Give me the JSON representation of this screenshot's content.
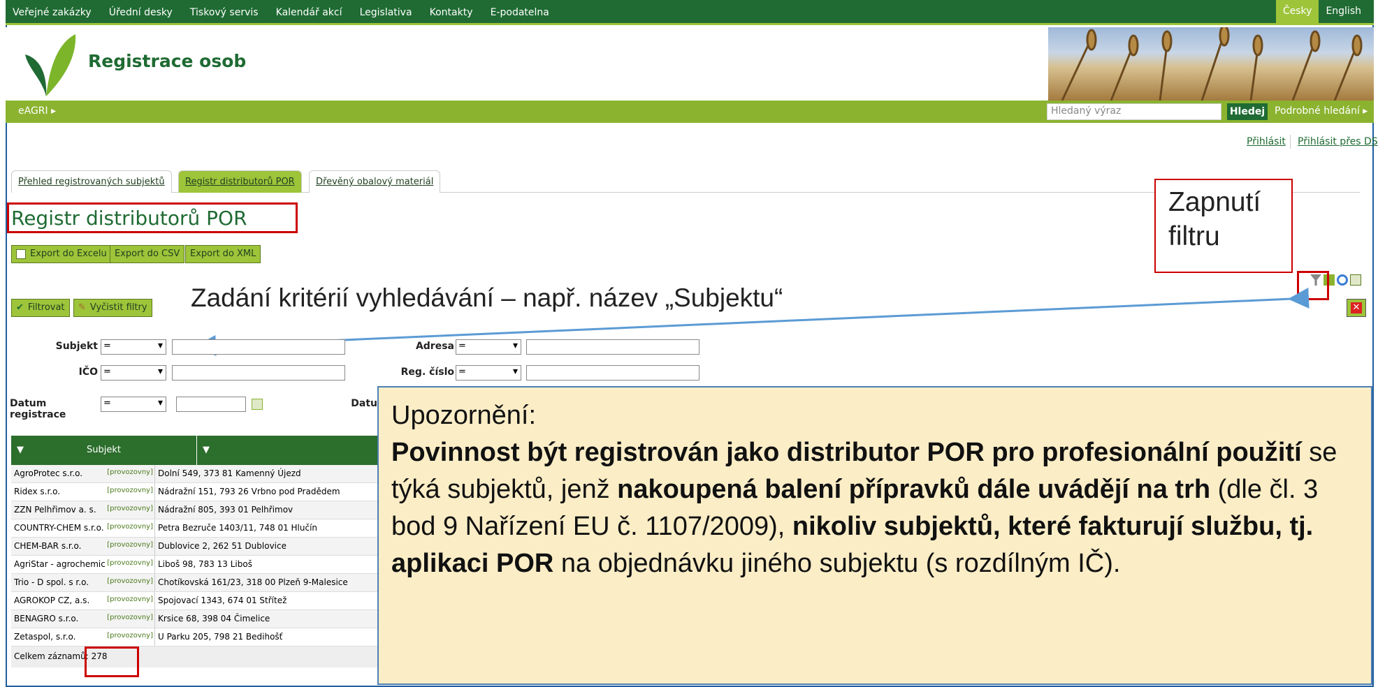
{
  "topnav": {
    "items": [
      "Veřejné zakázky",
      "Úřední desky",
      "Tiskový servis",
      "Kalendář akcí",
      "Legislativa",
      "Kontakty",
      "E-podatelna"
    ],
    "lang_cz": "Česky",
    "lang_en": "English"
  },
  "header": {
    "title": "Registrace osob"
  },
  "searchbar": {
    "eagri": "eAGRI ▸",
    "placeholder": "Hledaný výraz",
    "button": "Hledej",
    "advanced": "Podrobné hledání ▸"
  },
  "login": {
    "login": "Přihlásit",
    "login_ds": "Přihlásit přes DS"
  },
  "tabs": [
    "Přehled registrovaných subjektů",
    "Registr distributorů POR",
    "Dřevěný obalový materiál"
  ],
  "page": {
    "title": "Registr distributorů POR"
  },
  "export": {
    "excel": "Export do Excelu",
    "csv": "Export do CSV",
    "xml": "Export do XML"
  },
  "filter": {
    "apply": "Filtrovat",
    "clear": "Vyčistit filtry",
    "subjekt_label": "Subjekt",
    "adresa_label": "Adresa",
    "ico_label": "IČO",
    "regcislo_label": "Reg. číslo",
    "datum_label": "Datum registrace",
    "datum2_label": "Datu",
    "op": "="
  },
  "annotations": {
    "criteria": "Zadání kritérií vyhledávání – např. název „Subjektu“",
    "filter_on": "Zapnutí filtru"
  },
  "grid": {
    "col_subjekt": "Subjekt",
    "link": "[provozovny]",
    "rows": [
      {
        "name": "AgroProtec s.r.o.",
        "addr": "Dolní 549, 373 81 Kamenný Újezd"
      },
      {
        "name": "Ridex s.r.o.",
        "addr": "Nádražní 151, 793 26 Vrbno pod Pradědem"
      },
      {
        "name": "ZZN Pelhřimov a. s.",
        "addr": "Nádražní 805, 393 01 Pelhřimov"
      },
      {
        "name": "COUNTRY-CHEM s.r.o.",
        "addr": "Petra Bezruče 1403/11, 748 01 Hlučín"
      },
      {
        "name": "CHEM-BAR s.r.o.",
        "addr": "Dublovice 2, 262 51 Dublovice"
      },
      {
        "name": "AgriStar - agrochemicals s.r.o.",
        "addr": "Liboš 98, 783 13 Liboš"
      },
      {
        "name": "Trio - D spol. s r.o.",
        "addr": "Chotíkovská 161/23, 318 00 Plzeň 9-Malesice"
      },
      {
        "name": "AGROKOP CZ, a.s.",
        "addr": "Spojovací 1343, 674 01 Střítež"
      },
      {
        "name": "BENAGRO s.r.o.",
        "addr": "Krsice 68, 398 04 Čimelice"
      },
      {
        "name": "Zetaspol, s.r.o.",
        "addr": "U Parku 205, 798 21 Bedihošť"
      }
    ],
    "total_label": "Celkem záznamů:",
    "total": "278"
  },
  "notice": {
    "heading": "Upozornění:",
    "p1_bold": "Povinnost být registrován jako distributor POR pro profesionální použití",
    "p2": " se týká subjektů, jenž ",
    "p3_bold": "nakoupená balení přípravků dále uvádějí na trh",
    "p4": " (dle čl. 3 bod 9 Nařízení EU č. 1107/2009), ",
    "p5_bold": "nikoliv subjektů, které fakturují službu, tj. aplikaci POR",
    "p6": " na objednávku jiného subjektu (s rozdílným IČ)."
  }
}
